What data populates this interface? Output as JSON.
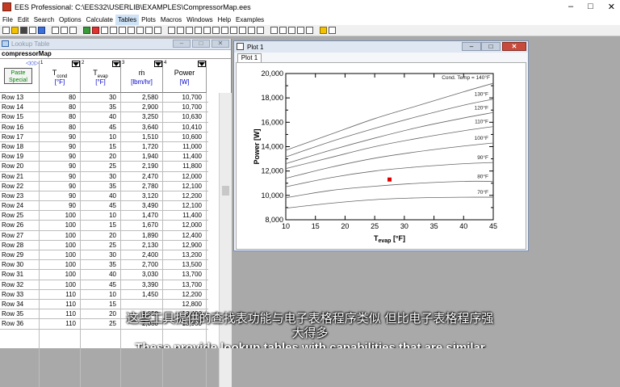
{
  "window": {
    "title": "EES Professional:  C:\\EES32\\USERLIB\\EXAMPLES\\CompressorMap.ees"
  },
  "menu": [
    "File",
    "Edit",
    "Search",
    "Options",
    "Calculate",
    "Tables",
    "Plots",
    "Macros",
    "Windows",
    "Help",
    "Examples"
  ],
  "menu_active": "Tables",
  "lookup": {
    "window_title": "Lookup Table",
    "table_name": "compressorMap",
    "paste_label": "Paste\nSpecial",
    "columns": [
      {
        "num": "1",
        "name": "Tcond",
        "unit": "[°F]"
      },
      {
        "num": "2",
        "name": "Tevap",
        "unit": "[°F]"
      },
      {
        "num": "3",
        "name": "m",
        "unit": "[lbm/hr]"
      },
      {
        "num": "4",
        "name": "Power",
        "unit": "[W]"
      }
    ],
    "rows": [
      [
        "Row 13",
        "80",
        "30",
        "2,580",
        "10,700"
      ],
      [
        "Row 14",
        "80",
        "35",
        "2,900",
        "10,700"
      ],
      [
        "Row 15",
        "80",
        "40",
        "3,250",
        "10,630"
      ],
      [
        "Row 16",
        "80",
        "45",
        "3,640",
        "10,410"
      ],
      [
        "Row 17",
        "90",
        "10",
        "1,510",
        "10,600"
      ],
      [
        "Row 18",
        "90",
        "15",
        "1,720",
        "11,000"
      ],
      [
        "Row 19",
        "90",
        "20",
        "1,940",
        "11,400"
      ],
      [
        "Row 20",
        "90",
        "25",
        "2,190",
        "11,800"
      ],
      [
        "Row 21",
        "90",
        "30",
        "2,470",
        "12,000"
      ],
      [
        "Row 22",
        "90",
        "35",
        "2,780",
        "12,100"
      ],
      [
        "Row 23",
        "90",
        "40",
        "3,120",
        "12,200"
      ],
      [
        "Row 24",
        "90",
        "45",
        "3,490",
        "12,100"
      ],
      [
        "Row 25",
        "100",
        "10",
        "1,470",
        "11,400"
      ],
      [
        "Row 26",
        "100",
        "15",
        "1,670",
        "12,000"
      ],
      [
        "Row 27",
        "100",
        "20",
        "1,890",
        "12,400"
      ],
      [
        "Row 28",
        "100",
        "25",
        "2,130",
        "12,900"
      ],
      [
        "Row 29",
        "100",
        "30",
        "2,400",
        "13,200"
      ],
      [
        "Row 30",
        "100",
        "35",
        "2,700",
        "13,500"
      ],
      [
        "Row 31",
        "100",
        "40",
        "3,030",
        "13,700"
      ],
      [
        "Row 32",
        "100",
        "45",
        "3,390",
        "13,700"
      ],
      [
        "Row 33",
        "110",
        "10",
        "1,450",
        "12,200"
      ],
      [
        "Row 34",
        "110",
        "15",
        "",
        "12,800"
      ],
      [
        "Row 35",
        "110",
        "20",
        "1,850",
        "13,400"
      ],
      [
        "Row 36",
        "110",
        "25",
        "2,080",
        "13,900"
      ]
    ]
  },
  "plot": {
    "window_title": "Plot 1",
    "tab": "Plot 1"
  },
  "chart_data": {
    "type": "line",
    "title": "",
    "xlabel": "Tevap  [°F]",
    "ylabel": "Power  [W]",
    "xlim": [
      10,
      45
    ],
    "ylim": [
      8000,
      20000
    ],
    "xticks": [
      10,
      15,
      20,
      25,
      30,
      35,
      40,
      45
    ],
    "yticks": [
      "8,000",
      "10,000",
      "12,000",
      "14,000",
      "16,000",
      "18,000",
      "20,000"
    ],
    "yticks_values": [
      8000,
      10000,
      12000,
      14000,
      16000,
      18000,
      20000
    ],
    "x": [
      10,
      17.5,
      25,
      32.5,
      40,
      45
    ],
    "series": [
      {
        "name": "Cond. Temp = 140°F",
        "values": [
          13700,
          15000,
          16300,
          17400,
          18500,
          19200
        ]
      },
      {
        "name": "130°F",
        "values": [
          13150,
          14400,
          15500,
          16500,
          17400,
          17900
        ]
      },
      {
        "name": "120°F",
        "values": [
          12600,
          13700,
          14700,
          15600,
          16350,
          16800
        ]
      },
      {
        "name": "110°F",
        "values": [
          12200,
          13100,
          14000,
          14700,
          15300,
          15650
        ]
      },
      {
        "name": "100°F",
        "values": [
          11400,
          12300,
          13050,
          13600,
          14050,
          14300
        ]
      },
      {
        "name": "90°F",
        "values": [
          10700,
          11450,
          12000,
          12350,
          12600,
          12700
        ]
      },
      {
        "name": "80°F",
        "values": [
          9800,
          10400,
          10750,
          11000,
          11150,
          11150
        ]
      },
      {
        "name": "70°F",
        "values": [
          8950,
          9350,
          9650,
          9800,
          9850,
          9850
        ]
      }
    ],
    "marker": {
      "x": 27.5,
      "y": 11300,
      "color": "#e00000"
    },
    "line_color": "#666666"
  },
  "subtitles": {
    "line1": "这些工具提供的查找表功能与电子表格程序类似 但比电子表格程序强\n大得多",
    "line2": "These provide lookup tables with capabilities that are similar"
  }
}
